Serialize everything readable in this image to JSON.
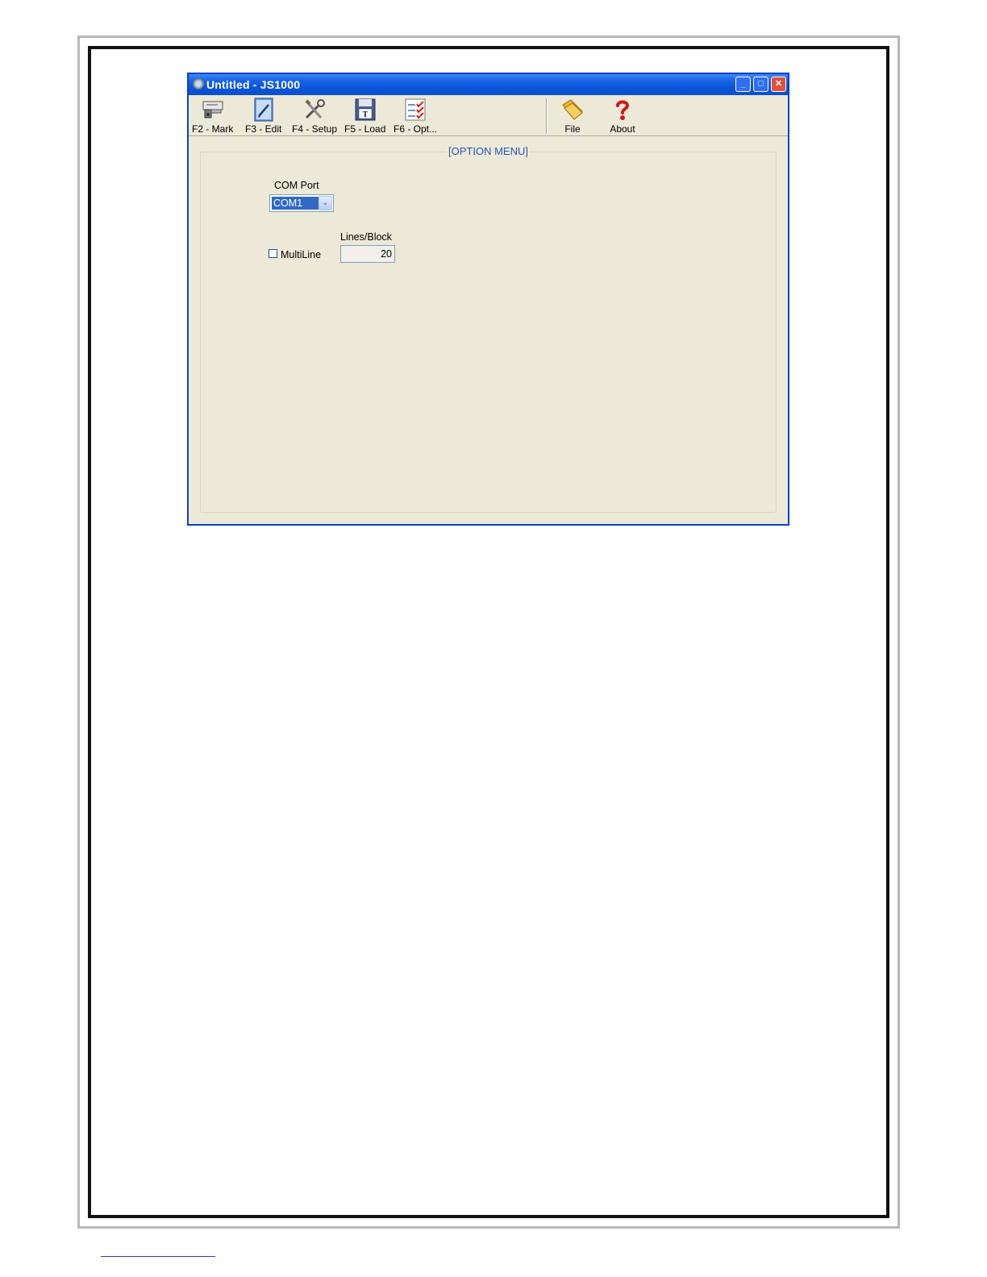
{
  "window": {
    "title": "Untitled - JS1000"
  },
  "toolbar": {
    "items": [
      {
        "label": "F2 - Mark",
        "icon": "printer-icon"
      },
      {
        "label": "F3 - Edit",
        "icon": "pencil-icon"
      },
      {
        "label": "F4 - Setup",
        "icon": "tools-icon"
      },
      {
        "label": "F5 - Load",
        "icon": "floppy-disk-icon"
      },
      {
        "label": "F6 - Opt...",
        "icon": "checklist-icon"
      },
      {
        "label": "File",
        "icon": "folder-icon"
      },
      {
        "label": "About",
        "icon": "question-mark-icon"
      }
    ]
  },
  "options": {
    "group_title": "[OPTION MENU]",
    "com_port_label": "COM Port",
    "com_port_value": "COM1",
    "lines_per_block_label": "Lines/Block",
    "multiline_label": "MultiLine",
    "multiline_checked": false,
    "lines_per_block_value": "20"
  },
  "colors": {
    "titlebar": "#0a52d8",
    "selection": "#316ac5",
    "group_title": "#2a55b4",
    "close_button": "#e1503a"
  }
}
